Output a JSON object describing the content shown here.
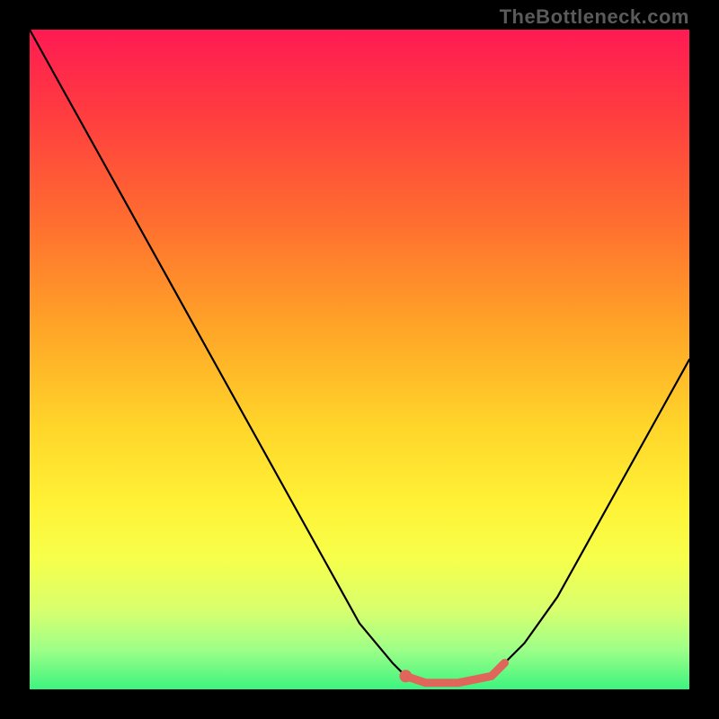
{
  "attribution_text": "TheBottleneck.com",
  "chart_data": {
    "type": "line",
    "title": "",
    "xlabel": "",
    "ylabel": "",
    "x": [
      0.0,
      0.05,
      0.1,
      0.15,
      0.2,
      0.25,
      0.3,
      0.35,
      0.4,
      0.45,
      0.5,
      0.55,
      0.57,
      0.6,
      0.62,
      0.65,
      0.7,
      0.72,
      0.75,
      0.8,
      0.85,
      0.9,
      0.95,
      1.0
    ],
    "values": [
      1.0,
      0.91,
      0.82,
      0.73,
      0.64,
      0.55,
      0.46,
      0.37,
      0.28,
      0.19,
      0.1,
      0.04,
      0.02,
      0.01,
      0.01,
      0.01,
      0.02,
      0.04,
      0.07,
      0.14,
      0.23,
      0.32,
      0.41,
      0.5
    ],
    "xlim": [
      0,
      1
    ],
    "ylim": [
      0,
      1
    ],
    "highlight_range_x": [
      0.57,
      0.72
    ],
    "legend": false,
    "grid": false,
    "annotations": []
  },
  "colors": {
    "frame": "#000000",
    "curve": "#000000",
    "highlight": "#e0665c",
    "gradient_top": "#ff1a53",
    "gradient_bottom": "#3cf47e"
  }
}
